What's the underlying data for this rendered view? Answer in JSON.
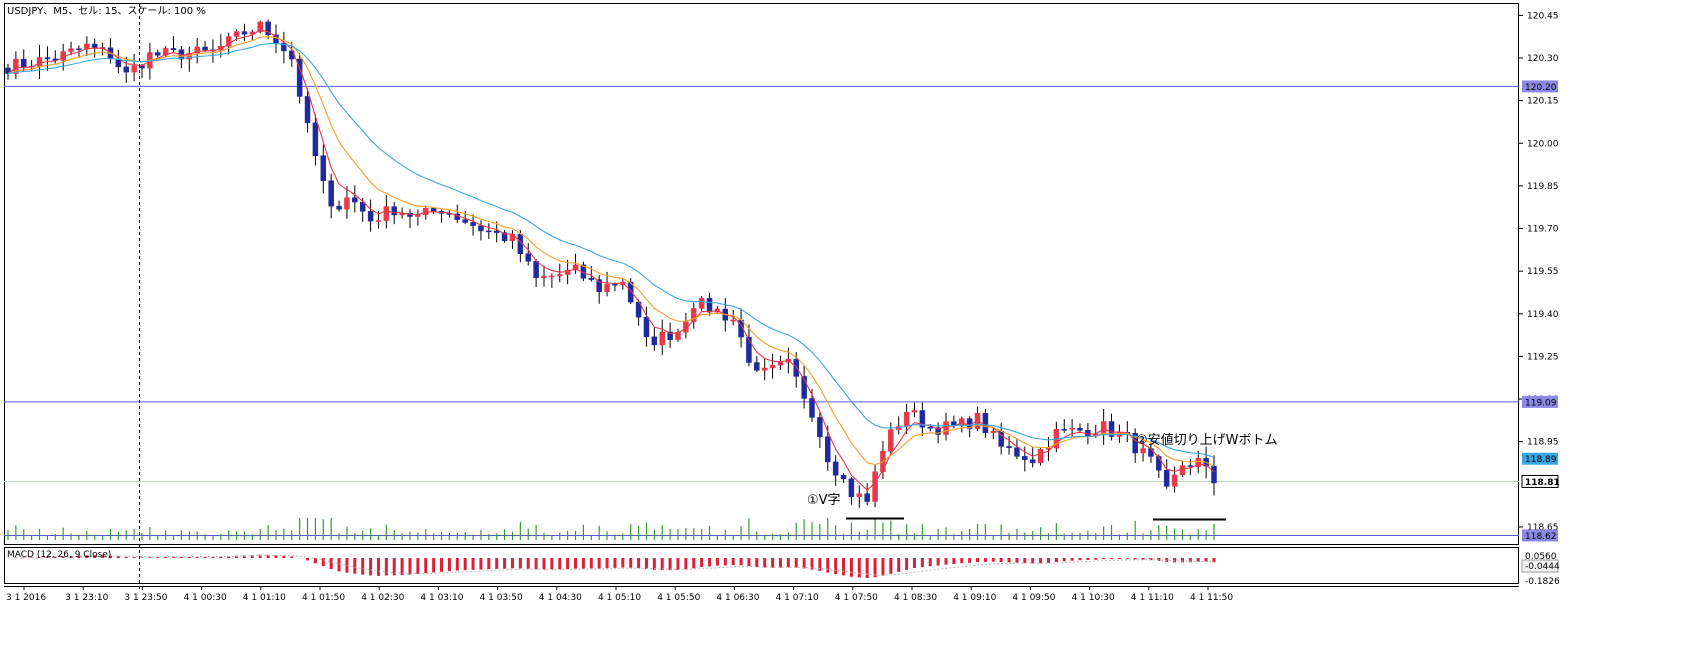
{
  "header": {
    "title": "USDJPY、M5、セル: 15、スケール: 100 %"
  },
  "macd": {
    "label": "MACD (12, 26, 9 Close)",
    "value_labels": [
      "0.0560",
      "-0.0444",
      "-0.1826"
    ]
  },
  "annotations": {
    "v_shape": "①V字",
    "w_bottom": "②安値切り上げWボトム"
  },
  "colors": {
    "bull_body": "#e8394a",
    "bear_body": "#1f2a9c",
    "ma_fast": "#e8394a",
    "ma_mid": "#f5a028",
    "ma_slow": "#3aa7e0",
    "volume": "#2e9f2e",
    "hline": "#5a5ad6",
    "macd_bar": "#d8203a"
  },
  "chart_data": {
    "type": "candlestick",
    "symbol": "USDJPY",
    "timeframe": "M5",
    "y_axis": {
      "ylim": [
        118.59,
        120.49
      ],
      "tick_labels": [
        "120.45",
        "120.30",
        "120.15",
        "120.00",
        "119.85",
        "119.70",
        "119.55",
        "119.40",
        "119.25",
        "119.10",
        "118.95",
        "118.65"
      ],
      "highlight_labels": [
        {
          "value": "120.20",
          "price": 120.2
        },
        {
          "value": "119.09",
          "price": 119.09
        },
        {
          "value": "118.89",
          "price": 118.89
        },
        {
          "value": "118.81",
          "price": 118.81
        },
        {
          "value": "118.62",
          "price": 118.62
        }
      ]
    },
    "x_axis": {
      "tick_labels": [
        "3 1 2016",
        "3 1 23:10",
        "3 1 23:50",
        "4 1 00:30",
        "4 1 01:10",
        "4 1 01:50",
        "4 1 02:30",
        "4 1 03:10",
        "4 1 03:50",
        "4 1 04:30",
        "4 1 05:10",
        "4 1 05:50",
        "4 1 06:30",
        "4 1 07:10",
        "4 1 07:50",
        "4 1 08:30",
        "4 1 09:10",
        "4 1 09:50",
        "4 1 10:30",
        "4 1 11:10",
        "4 1 11:50"
      ]
    },
    "horizontal_lines": [
      120.2,
      119.09
    ],
    "current_price_line": 118.81,
    "anchors": [
      [
        0,
        120.27
      ],
      [
        6,
        120.3
      ],
      [
        10,
        120.34
      ],
      [
        13,
        120.31
      ],
      [
        15,
        120.24
      ],
      [
        18,
        120.31
      ],
      [
        26,
        120.32
      ],
      [
        30,
        120.39
      ],
      [
        32,
        120.41
      ],
      [
        34,
        120.37
      ],
      [
        36,
        120.3
      ],
      [
        38,
        120.05
      ],
      [
        41,
        119.76
      ],
      [
        43,
        119.82
      ],
      [
        46,
        119.73
      ],
      [
        49,
        119.77
      ],
      [
        52,
        119.74
      ],
      [
        55,
        119.77
      ],
      [
        60,
        119.7
      ],
      [
        64,
        119.66
      ],
      [
        67,
        119.52
      ],
      [
        72,
        119.55
      ],
      [
        75,
        119.49
      ],
      [
        78,
        119.52
      ],
      [
        81,
        119.3
      ],
      [
        85,
        119.34
      ],
      [
        87,
        119.44
      ],
      [
        90,
        119.41
      ],
      [
        92,
        119.38
      ],
      [
        95,
        119.18
      ],
      [
        99,
        119.22
      ],
      [
        102,
        119.06
      ],
      [
        104,
        118.9
      ],
      [
        107,
        118.77
      ],
      [
        109,
        118.74
      ],
      [
        111,
        118.93
      ],
      [
        114,
        119.06
      ],
      [
        117,
        119.0
      ],
      [
        120,
        119.0
      ],
      [
        123,
        119.03
      ],
      [
        126,
        118.93
      ],
      [
        130,
        118.89
      ],
      [
        133,
        118.98
      ],
      [
        136,
        118.99
      ],
      [
        139,
        119.0
      ],
      [
        142,
        118.96
      ],
      [
        145,
        118.88
      ],
      [
        147,
        118.77
      ],
      [
        149,
        118.87
      ],
      [
        151,
        118.88
      ],
      [
        153,
        118.81
      ]
    ],
    "bars": 154,
    "moving_averages": [
      "fast",
      "mid",
      "slow"
    ],
    "macd_range": [
      -0.1826,
      0.056
    ]
  }
}
